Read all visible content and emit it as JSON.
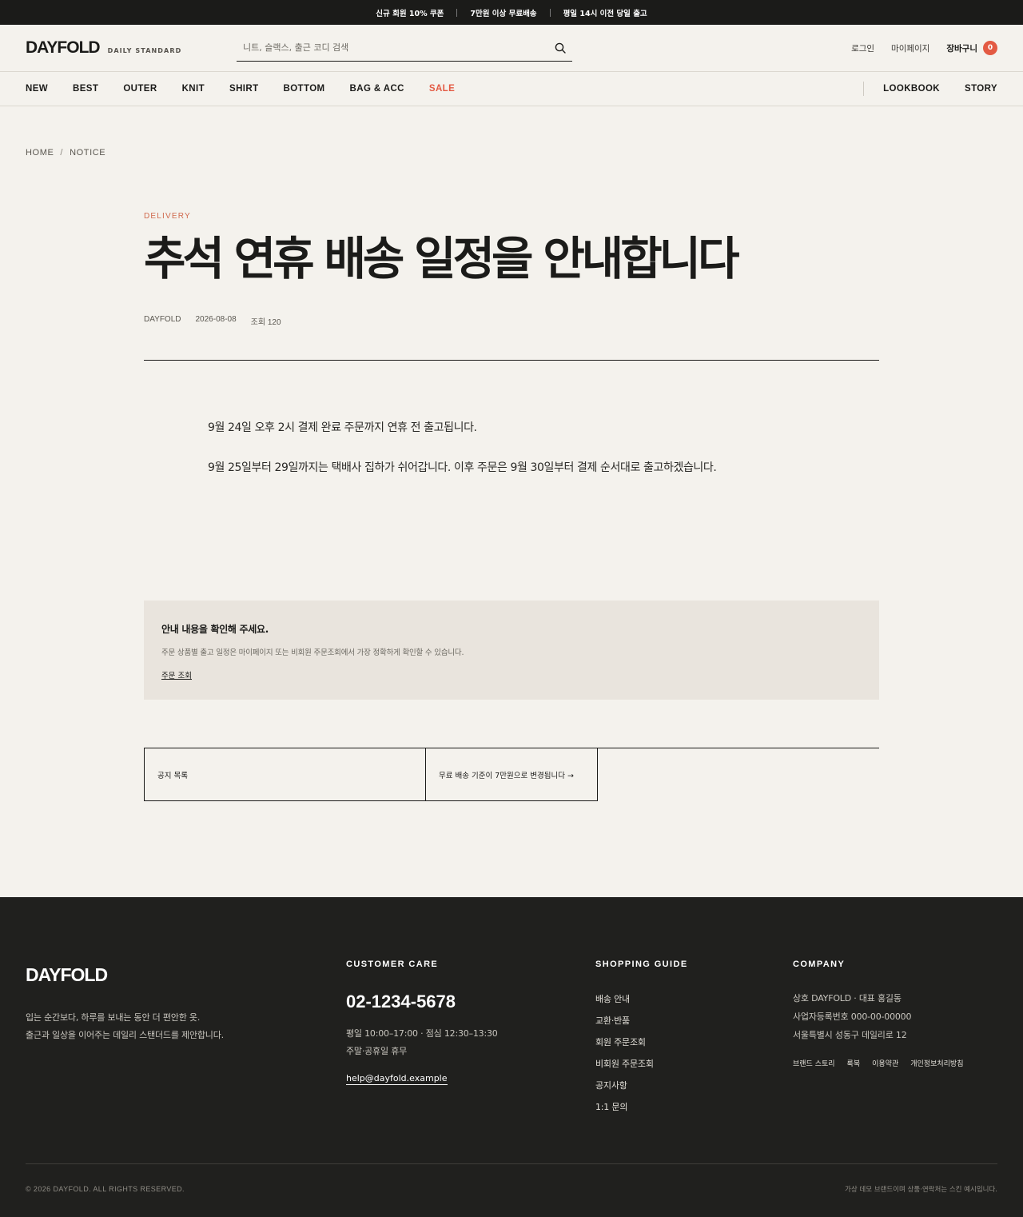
{
  "announcement": {
    "items": [
      "신규 회원 10% 쿠폰",
      "7만원 이상 무료배송",
      "평일 14시 이전 당일 출고"
    ]
  },
  "header": {
    "logo": "DAYFOLD",
    "logo_sub": "DAILY STANDARD",
    "search": {
      "placeholder": "니트, 슬랙스, 출근 코디 검색",
      "icon": "search-icon"
    },
    "login": "로그인",
    "mypage": "마이페이지",
    "cart": {
      "label": "장바구니",
      "count": "0"
    }
  },
  "nav": {
    "items": [
      "NEW",
      "BEST",
      "OUTER",
      "KNIT",
      "SHIRT",
      "BOTTOM",
      "BAG & ACC",
      "SALE"
    ],
    "right": [
      "LOOKBOOK",
      "STORY"
    ]
  },
  "breadcrumb": {
    "home": "HOME",
    "separator": "/",
    "current": "NOTICE"
  },
  "notice": {
    "category": "DELIVERY",
    "title": "추석 연휴 배송 일정을 안내합니다",
    "author": "DAYFOLD",
    "date": "2026-08-08",
    "views": "조회 120",
    "body": [
      "9월 24일 오후 2시 결제 완료 주문까지 연휴 전 출고됩니다.",
      "9월 25일부터 29일까지는 택배사 집하가 쉬어갑니다. 이후 주문은 9월 30일부터 결제 순서대로 출고하겠습니다."
    ]
  },
  "info_box": {
    "title": "안내 내용을 확인해 주세요.",
    "description": "주문 상품별 출고 일정은 마이페이지 또는 비회원 주문조회에서 가장 정확하게 확인할 수 있습니다.",
    "link": "주문 조회"
  },
  "post_nav": {
    "list": "공지 목록",
    "next": "무료 배송 기준이 7만원으로 변경됩니다 →"
  },
  "footer": {
    "logo": "DAYFOLD",
    "tagline": [
      "입는 순간보다, 하루를 보내는 동안 더 편안한 옷.",
      "출근과 일상을 이어주는 데일리 스탠더드를 제안합니다."
    ],
    "customer_care": {
      "title": "CUSTOMER CARE",
      "phone": "02-1234-5678",
      "hours": [
        "평일 10:00–17:00 · 점심 12:30–13:30",
        "주말·공휴일 휴무"
      ],
      "email": "help@dayfold.example"
    },
    "shopping_guide": {
      "title": "SHOPPING GUIDE",
      "items": [
        "배송 안내",
        "교환·반품",
        "회원 주문조회",
        "비회원 주문조회",
        "공지사항",
        "1:1 문의"
      ]
    },
    "company": {
      "title": "COMPANY",
      "lines": [
        "상호 DAYFOLD · 대표 홍길동",
        "사업자등록번호 000-00-00000",
        "서울특별시 성동구 데일리로 12"
      ],
      "links": [
        "브랜드 스토리",
        "룩북",
        "이용약관",
        "개인정보처리방침"
      ]
    },
    "copyright": "© 2026 DAYFOLD. ALL RIGHTS RESERVED.",
    "disclaimer": "가상 데모 브랜드이며 상품·연락처는 스킨 예시입니다."
  },
  "colors": {
    "accent": "#e35a43",
    "category": "#d0694d",
    "ink": "#1b1b19",
    "background": "#f4f2ed",
    "footer": "#20201e",
    "info_box": "#e9e4dd"
  }
}
